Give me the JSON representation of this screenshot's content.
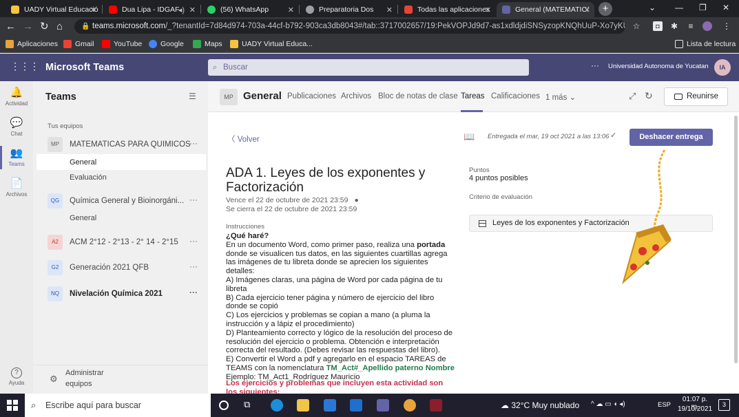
{
  "browser": {
    "tabs": [
      {
        "title": "UADY Virtual Educació",
        "color": "#f5c242"
      },
      {
        "title": "Dua Lipa - IDGAF",
        "color": "#ff0000"
      },
      {
        "title": "(56) WhatsApp",
        "color": "#25d366"
      },
      {
        "title": "Preparatoria Dos",
        "color": "#9aa0a6"
      },
      {
        "title": "Todas las aplicaciones",
        "color": "#ea4335"
      },
      {
        "title": "General (MATEMATIC/",
        "color": "#6264a7"
      }
    ],
    "new_tab": "+",
    "url_host": "teams.microsoft.com",
    "url_rest": "/_?tenantId=7d84d974-703a-44cf-b792-903ca3db8043#/tab::3717002657/19:PekVOPJd9d7-as1xdldjdiSNSyzopKNQhUuP-Xo7yKU1@thr...",
    "bookmarks": [
      {
        "label": "Aplicaciones",
        "color": "#e8a33d"
      },
      {
        "label": "Gmail",
        "color": "#ea4335"
      },
      {
        "label": "YouTube",
        "color": "#ff0000"
      },
      {
        "label": "Google",
        "color": "#4285f4"
      },
      {
        "label": "Maps",
        "color": "#34a853"
      },
      {
        "label": "UADY Virtual Educa...",
        "color": "#f5c242"
      }
    ],
    "reading_list": "Lista de lectura"
  },
  "teams": {
    "app_title": "Microsoft Teams",
    "search_placeholder": "Buscar",
    "org": "Universidad Autonoma de Yucatan",
    "avatar": "IA",
    "more": "···"
  },
  "rail": [
    {
      "label": "Actividad",
      "icon": "🔔"
    },
    {
      "label": "Chat",
      "icon": "💬"
    },
    {
      "label": "Teams",
      "icon": "👥"
    },
    {
      "label": "Archivos",
      "icon": "📄"
    },
    {
      "label": "Ayuda",
      "icon": "?"
    }
  ],
  "teamlist": {
    "title": "Teams",
    "section": "Tus equipos",
    "teams": [
      {
        "abbr": "MP",
        "name": "MATEMATICAS PARA QUIMICOS",
        "bg": "#e1e1e1",
        "fg": "#616161"
      },
      {
        "abbr": "QG",
        "name": "Química General y Bioinorgáni...",
        "bg": "#dce6f7",
        "fg": "#2c5db5"
      },
      {
        "abbr": "A2",
        "name": "ACM 2°12 - 2°13 - 2° 14 - 2°15",
        "bg": "#f6d4d4",
        "fg": "#b5402c"
      },
      {
        "abbr": "G2",
        "name": "Generación 2021 QFB",
        "bg": "#dce6f7",
        "fg": "#2c5db5"
      },
      {
        "abbr": "NQ",
        "name": "Nivelación Química 2021",
        "bg": "#dce6f7",
        "fg": "#2c5db5"
      }
    ],
    "channels": {
      "general1": "General",
      "evaluacion": "Evaluación",
      "general2": "General"
    },
    "admin": "Administrar equipos"
  },
  "channel": {
    "badge": "MP",
    "name": "General",
    "tabs": [
      "Publicaciones",
      "Archivos",
      "Bloc de notas de clase",
      "Tareas",
      "Calificaciones",
      "1 más ⌄"
    ],
    "meet": "Reunirse"
  },
  "assignment": {
    "back": "Volver",
    "title": "ADA 1. Leyes de los exponentes y Factorización",
    "due": "Vence el 22 de octubre de 2021 23:59",
    "closes": "Se cierra el 22 de octubre de 2021 23:59",
    "instructions_label": "Instrucciones",
    "q": "¿Qué haré?",
    "p1a": "En un documento Word, como primer paso, realiza una ",
    "p1b": "portada",
    "p1c": " donde se visualicen tus datos, en las siguientes cuartillas agrega las imágenes de tu libreta donde se aprecien los siguientes detalles:",
    "a": "A) Imágenes claras, una página de Word por cada página de tu libreta",
    "b": "B) Cada ejercicio tener página y número de ejercicio del libro donde se copió",
    "c": "C) Los ejercicios y problemas se copian a mano (a pluma la instrucción y a lápiz el procedimiento)",
    "d": "D) Planteamiento correcto y lógico de la resolución del proceso de resolución del ejercicio o problema. Obtención e interpretación correcta del resultado. (Debes revisar las respuestas del libro).",
    "e1": "E) Convertir el Word a pdf y agregarlo en el espacio TAREAS de TEAMS con la nomenclatura ",
    "e2": "TM_Act#_Apellido paterno Nombre",
    "example": "Ejemplo: TM_Act1_Rodríguez Mauricio",
    "red": "Los ejercicios y problemas que incluyen esta actividad son los siguientes:",
    "submitted": "Entregada el mar, 19 oct 2021 a las 13:06",
    "undo": "Deshacer entrega",
    "points_label": "Puntos",
    "points": "4 puntos posibles",
    "rubric_label": "Criterio de evaluación",
    "rubric": "Leyes de los exponentes y Factorización"
  },
  "taskbar": {
    "search": "Escribe aquí para buscar",
    "weather": "32°C  Muy nublado",
    "lang": "ESP",
    "time": "01:07 p. m.",
    "date": "19/10/2021"
  }
}
